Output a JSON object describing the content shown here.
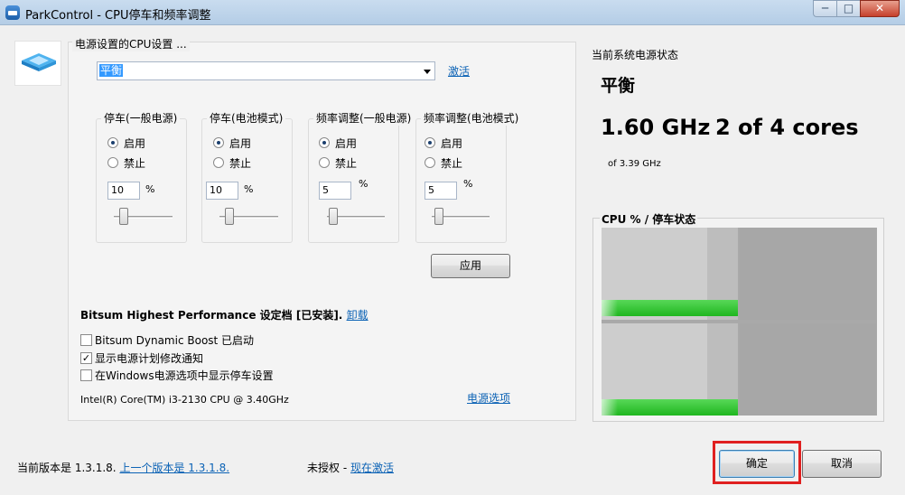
{
  "window": {
    "title": "ParkControl - CPU停车和频率调整",
    "min": "─",
    "max": "□",
    "close": "✕",
    "icon": "parkcontrol-icon"
  },
  "settings": {
    "title": "电源设置的CPU设置 ...",
    "plan_selected": "平衡",
    "activate_link": "激活",
    "groups": [
      {
        "title": "停车(一般电源)",
        "enable": "启用",
        "disable": "禁止",
        "value": "10",
        "unit": "%"
      },
      {
        "title": "停车(电池模式)",
        "enable": "启用",
        "disable": "禁止",
        "value": "10",
        "unit": "%"
      },
      {
        "title": "频率调整(一般电源)",
        "enable": "启用",
        "disable": "禁止",
        "value": "5",
        "unit": "%"
      },
      {
        "title": "频率调整(电池模式)",
        "enable": "启用",
        "disable": "禁止",
        "value": "5",
        "unit": "%"
      }
    ],
    "apply_button": "应用",
    "bitsum_profile": "Bitsum Highest Performance 设定档 [已安装].",
    "uninstall_link": "卸载",
    "checks": [
      {
        "label": "Bitsum Dynamic Boost 已启动",
        "checked": false
      },
      {
        "label": "显示电源计划修改通知",
        "checked": true
      },
      {
        "label": "在Windows电源选项中显示停车设置",
        "checked": false
      }
    ],
    "cpu_model": "Intel(R) Core(TM) i3-2130 CPU @ 3.40GHz",
    "power_options_link": "电源选项"
  },
  "status": {
    "title": "当前系统电源状态",
    "plan": "平衡",
    "frequency": "1.60 GHz",
    "cores": "2 of 4 cores",
    "max_frequency": "of 3.39 GHz",
    "cpu_box_title": "CPU % / 停车状态"
  },
  "footer": {
    "version_text": "当前版本是 1.3.1.8.",
    "prev_version_link": "上一个版本是 1.3.1.8.",
    "license_text": "未授权 -",
    "activate_now_link": "现在激活",
    "ok_button": "确定",
    "cancel_button": "取消"
  },
  "colors": {
    "accent": "#0b62b5",
    "highlight": "#e02020",
    "bar": "#2ec42e"
  }
}
